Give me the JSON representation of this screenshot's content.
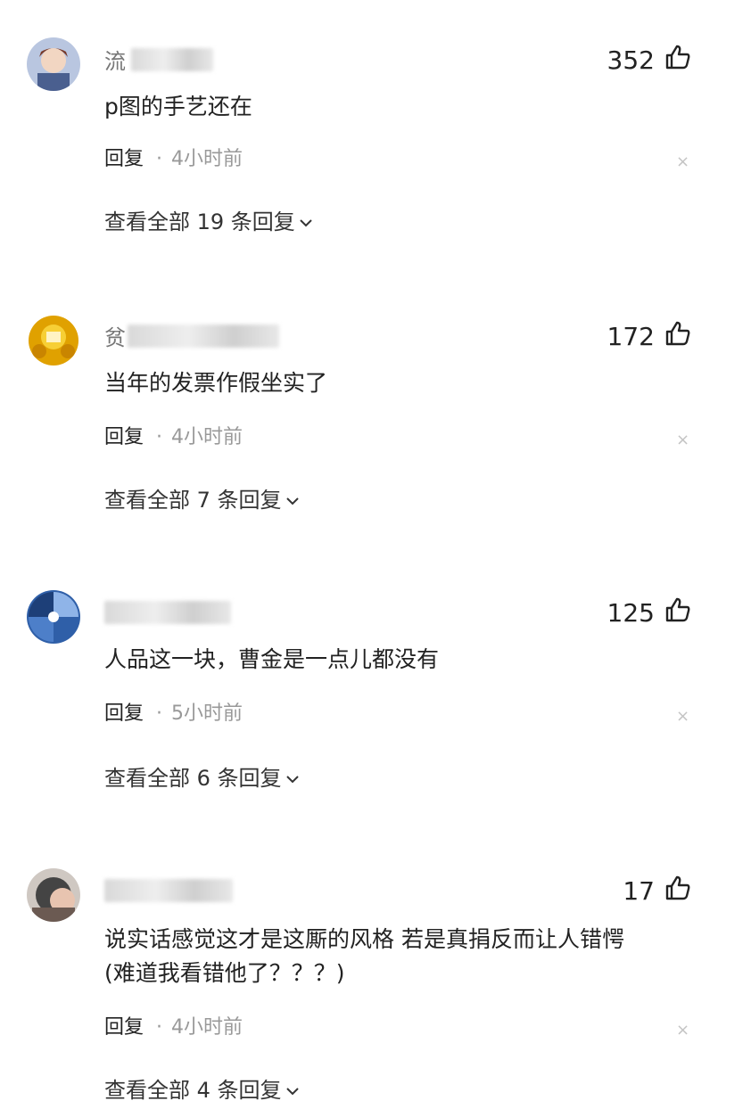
{
  "comments": [
    {
      "username": "流",
      "likes": "352",
      "lines": [
        "p图的手艺还在"
      ],
      "reply_label": "回复",
      "time": "4小时前",
      "view_all": "查看全部 19 条回复"
    },
    {
      "username": "贫",
      "likes": "172",
      "lines": [
        "当年的发票作假坐实了"
      ],
      "reply_label": "回复",
      "time": "4小时前",
      "view_all": "查看全部 7 条回复"
    },
    {
      "username": "",
      "likes": "125",
      "lines": [
        "人品这一块，曹金是一点儿都没有"
      ],
      "reply_label": "回复",
      "time": "5小时前",
      "view_all": "查看全部 6 条回复"
    },
    {
      "username": "",
      "likes": "17",
      "lines": [
        "说实话感觉这才是这厮的风格 若是真捐反而让人错愕",
        "(难道我看错他了？？？)"
      ],
      "reply_label": "回复",
      "time": "4小时前",
      "view_all": "查看全部 4 条回复"
    }
  ],
  "icons": {
    "like": "thumbs-up-icon",
    "close": "close-icon",
    "expand": "chevron-down-icon"
  },
  "colors": {
    "text": "#222222",
    "muted": "#999999",
    "close": "#c4c4c4"
  }
}
